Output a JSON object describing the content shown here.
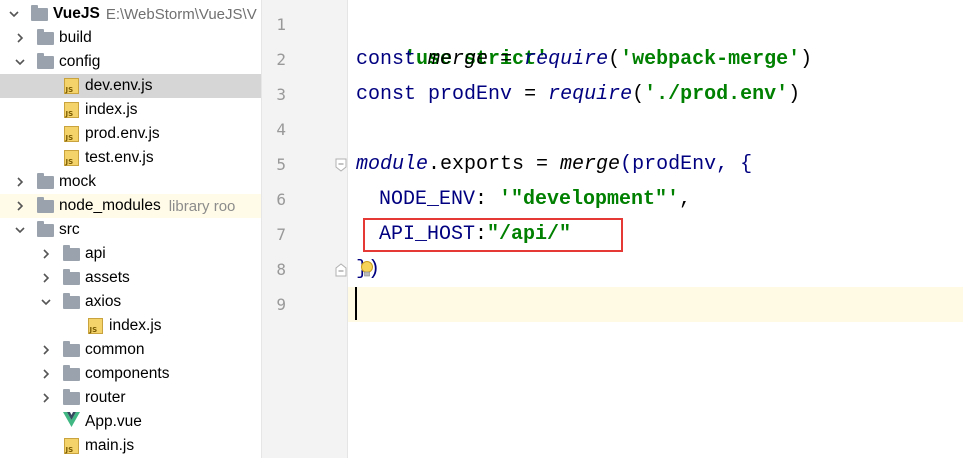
{
  "project": {
    "name": "VueJS",
    "path": "E:\\WebStorm\\VueJS\\V"
  },
  "tree": [
    {
      "label": "build",
      "kind": "folder"
    },
    {
      "label": "config",
      "kind": "folder",
      "expanded": true
    },
    {
      "label": "dev.env.js",
      "kind": "js",
      "selected": true
    },
    {
      "label": "index.js",
      "kind": "js"
    },
    {
      "label": "prod.env.js",
      "kind": "js"
    },
    {
      "label": "test.env.js",
      "kind": "js"
    },
    {
      "label": "mock",
      "kind": "folder"
    },
    {
      "label": "node_modules",
      "kind": "folder",
      "note": "library roo"
    },
    {
      "label": "src",
      "kind": "folder",
      "expanded": true
    },
    {
      "label": "api",
      "kind": "folder"
    },
    {
      "label": "assets",
      "kind": "folder"
    },
    {
      "label": "axios",
      "kind": "folder",
      "expanded": true
    },
    {
      "label": "index.js",
      "kind": "js"
    },
    {
      "label": "common",
      "kind": "folder"
    },
    {
      "label": "components",
      "kind": "folder"
    },
    {
      "label": "router",
      "kind": "folder"
    },
    {
      "label": "App.vue",
      "kind": "vue"
    },
    {
      "label": "main.js",
      "kind": "js"
    }
  ],
  "line_numbers": [
    "1",
    "2",
    "3",
    "4",
    "5",
    "6",
    "7",
    "8",
    "9"
  ],
  "code": {
    "l1": {
      "str": "'use strict'"
    },
    "l2": {
      "kw": "const",
      "var": "merge",
      "eq": "=",
      "fn": "require",
      "open": "(",
      "str": "'webpack-merge'",
      "close": ")"
    },
    "l3": {
      "kw": "const",
      "var": "prodEnv",
      "eq": "=",
      "fn": "require",
      "open": "(",
      "str": "'./prod.env'",
      "close": ")"
    },
    "l5": {
      "mod": "module",
      "rest": ".exports = ",
      "fn": "merge",
      "args": "(prodEnv, {"
    },
    "l6": {
      "key": "NODE_ENV",
      "colon": ": ",
      "str": "'\"development\"'",
      "comma": ","
    },
    "l7": {
      "key": "API_HOST",
      "colon": ":",
      "str": "\"/api/\""
    },
    "l8": {
      "text": "})"
    }
  },
  "colors": {
    "highlight_box": "#e53935",
    "caret_line": "#fffae3",
    "selected_row": "#d6d6d6",
    "keyword": "#000080",
    "string": "#008000"
  }
}
